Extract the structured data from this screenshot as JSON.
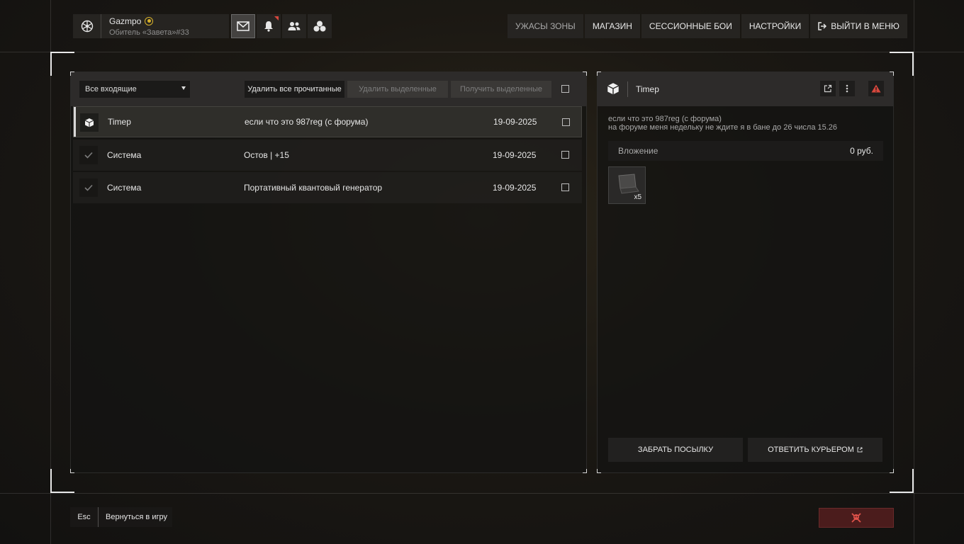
{
  "profile": {
    "name": "Gazmpo",
    "subtitle": "Обитель «Завета»#33"
  },
  "top_icons": [
    {
      "name": "mail-icon",
      "active": true
    },
    {
      "name": "bell-icon",
      "has_alert": true
    },
    {
      "name": "friends-icon"
    },
    {
      "name": "group-icon"
    }
  ],
  "nav": {
    "horrors": "УЖАСЫ ЗОНЫ",
    "shop": "МАГАЗИН",
    "session": "СЕССИОННЫЕ БОИ",
    "settings": "НАСТРОЙКИ",
    "exit": "ВЫЙТИ В МЕНЮ"
  },
  "inbox": {
    "filter": "Все входящие",
    "delete_read": "Удалить все прочитанные",
    "delete_selected": "Удалить выделенные",
    "receive_selected": "Получить выделенные",
    "messages": [
      {
        "sender": "Timep",
        "subject": "если что это 987reg (с форума)",
        "date": "19-09-2025",
        "icon": "package-icon",
        "selected": true
      },
      {
        "sender": "Система",
        "subject": "Остов | +15",
        "date": "19-09-2025",
        "icon": "check-icon",
        "selected": false
      },
      {
        "sender": "Система",
        "subject": "Портативный квантовый генератор",
        "date": "19-09-2025",
        "icon": "check-icon",
        "selected": false
      }
    ]
  },
  "detail": {
    "sender": "Timep",
    "line1": "если что это 987reg (с форума)",
    "line2": "на форуме меня недельку не ждите я в бане до 26 числа 15.26",
    "attachment_label": "Вложение",
    "attachment_value": "0 руб.",
    "item_qty": "x5",
    "take_button": "ЗАБРАТЬ ПОСЫЛКУ",
    "reply_button": "ОТВЕТИТЬ КУРЬЕРОМ"
  },
  "bottom": {
    "esc_key": "Esc",
    "back_label": "Вернуться в игру"
  },
  "colors": {
    "alert_red": "#d8473d",
    "gold": "#d9b22a"
  }
}
